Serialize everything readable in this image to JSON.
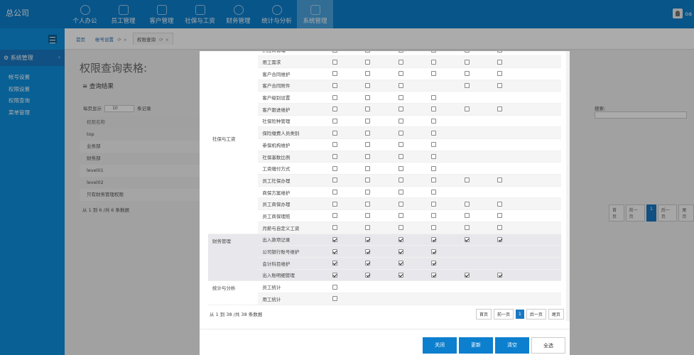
{
  "brand": "总公司",
  "nav": [
    {
      "label": "个人办公",
      "icon": "clock-icon"
    },
    {
      "label": "员工管理",
      "icon": "person-icon"
    },
    {
      "label": "客户管理",
      "icon": "phone-icon"
    },
    {
      "label": "社保与工资",
      "icon": "line-chart-icon"
    },
    {
      "label": "财务管理",
      "icon": "pie-chart-icon"
    },
    {
      "label": "统计与分析",
      "icon": "clock-icon"
    },
    {
      "label": "系统管理",
      "icon": "gear-icon",
      "active": true
    }
  ],
  "user": {
    "name": "oa"
  },
  "sidebar": {
    "section": "系统管理",
    "items": [
      "帐号设置",
      "权限设置",
      "权限查询",
      "菜单管理"
    ]
  },
  "tabs": [
    {
      "label": "首页"
    },
    {
      "label": "帐号设置",
      "closable": true
    },
    {
      "label": "权限查询",
      "closable": true,
      "active": true
    }
  ],
  "background": {
    "title": "权限查询表格:",
    "subtitle": "≡ 查询结果",
    "length_prefix": "每页显示",
    "length_value": "10",
    "length_suffix": "条记录",
    "search_label": "搜索:",
    "rows": [
      "权限名称",
      "top",
      "业务部",
      "财务部",
      "level01",
      "level02",
      "只有财务管理权限"
    ],
    "info": "从 1 到 6 /共 6 条数据",
    "pager": [
      "首页",
      "前一页",
      "1",
      "后一页",
      "尾页"
    ]
  },
  "permissions": [
    {
      "group": "",
      "name": "供应商管理",
      "checks": [
        0,
        0,
        0,
        0,
        0,
        0
      ]
    },
    {
      "group": "",
      "name": "用工需求",
      "checks": [
        0,
        0,
        0,
        0,
        0,
        0
      ]
    },
    {
      "group": "",
      "name": "客户合同维护",
      "checks": [
        0,
        0,
        0,
        0,
        0,
        0
      ]
    },
    {
      "group": "",
      "name": "客户合同附件",
      "checks": [
        0,
        0,
        0,
        null,
        0,
        0
      ]
    },
    {
      "group": "",
      "name": "客户级别设置",
      "checks": [
        0,
        0,
        0,
        0,
        null,
        null
      ]
    },
    {
      "group": "",
      "name": "客户跟进维护",
      "checks": [
        0,
        0,
        0,
        0,
        0,
        0
      ]
    },
    {
      "group": "社保与工资",
      "name": "社保险种管理",
      "checks": [
        0,
        0,
        0,
        0,
        null,
        null
      ]
    },
    {
      "group": "",
      "name": "保险缴费人员类别",
      "checks": [
        0,
        0,
        0,
        0,
        null,
        null
      ]
    },
    {
      "group": "",
      "name": "参保机构维护",
      "checks": [
        0,
        0,
        0,
        0,
        null,
        null
      ]
    },
    {
      "group": "",
      "name": "社保基数比例",
      "checks": [
        0,
        0,
        0,
        0,
        null,
        null
      ]
    },
    {
      "group": "",
      "name": "工资缴付方式",
      "checks": [
        0,
        0,
        0,
        0,
        null,
        null
      ]
    },
    {
      "group": "",
      "name": "员工社保办理",
      "checks": [
        0,
        0,
        0,
        0,
        0,
        0
      ]
    },
    {
      "group": "",
      "name": "商保方案维护",
      "checks": [
        0,
        0,
        0,
        0,
        null,
        null
      ]
    },
    {
      "group": "",
      "name": "员工商保办理",
      "checks": [
        0,
        0,
        0,
        0,
        0,
        0
      ]
    },
    {
      "group": "",
      "name": "员工商保理赔",
      "checks": [
        0,
        0,
        0,
        0,
        0,
        0
      ]
    },
    {
      "group": "",
      "name": "月薪与自定义工资",
      "checks": [
        0,
        0,
        0,
        0,
        0,
        0
      ]
    },
    {
      "group": "财务管理",
      "name": "出入款项记录",
      "checks": [
        1,
        1,
        1,
        1,
        1,
        1
      ]
    },
    {
      "group": "",
      "name": "公司银行账号维护",
      "checks": [
        1,
        1,
        1,
        1,
        null,
        null
      ]
    },
    {
      "group": "",
      "name": "会计科目维护",
      "checks": [
        1,
        1,
        1,
        1,
        null,
        null
      ]
    },
    {
      "group": "",
      "name": "出入账明细管理",
      "checks": [
        1,
        1,
        1,
        1,
        1,
        1
      ]
    },
    {
      "group": "统计与分析",
      "name": "员工统计",
      "checks": [
        0,
        null,
        null,
        null,
        null,
        null
      ]
    },
    {
      "group": "",
      "name": "用工统计",
      "checks": [
        0,
        null,
        null,
        null,
        null,
        null
      ]
    }
  ],
  "modal": {
    "info": "从 1 到 38 /共 38 条数据",
    "pager": [
      "首页",
      "前一页",
      "1",
      "后一页",
      "尾页"
    ],
    "buttons": [
      "关闭",
      "更新",
      "清空",
      "全选"
    ]
  }
}
